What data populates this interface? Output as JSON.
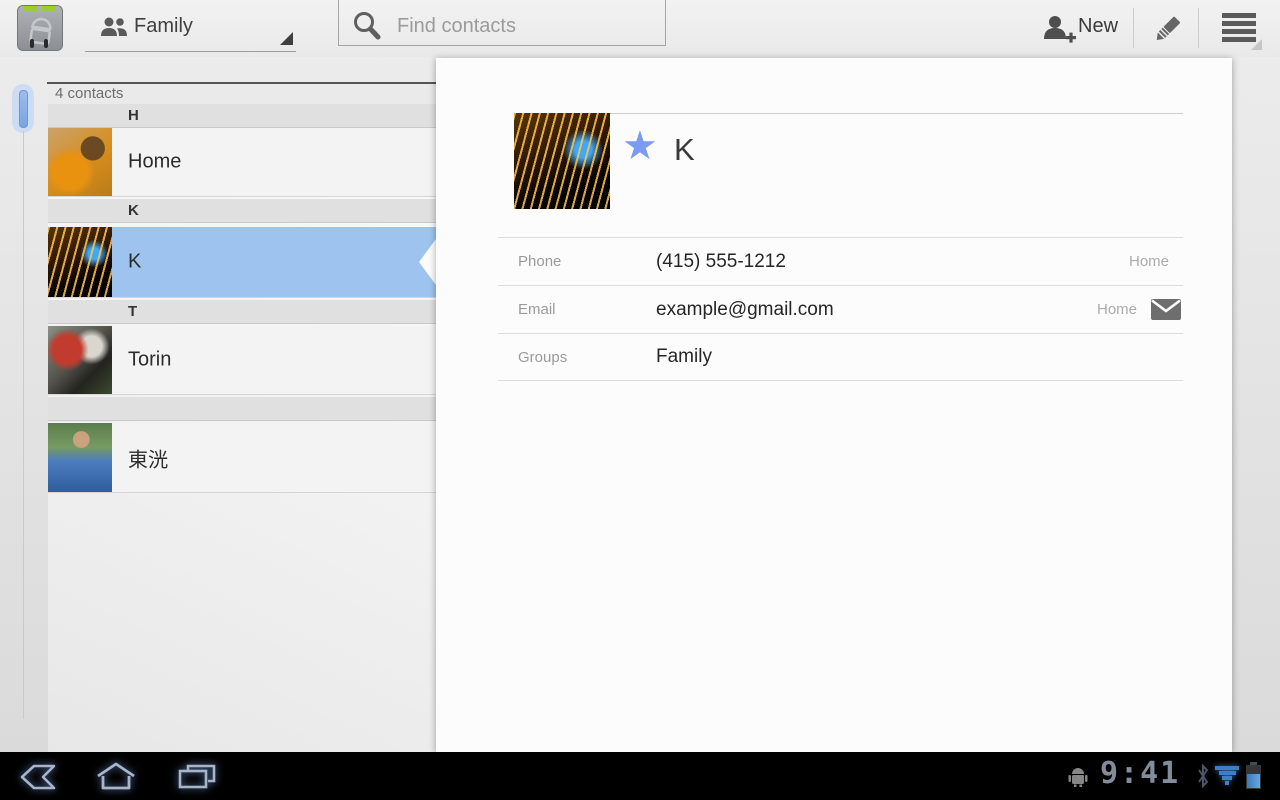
{
  "action_bar": {
    "group_selector_label": "Family",
    "search_placeholder": "Find contacts",
    "new_button_label": "New",
    "icons": [
      "contacts-app-icon",
      "group-icon",
      "search-icon",
      "add-contact-icon",
      "pencil-icon",
      "menu-icon"
    ]
  },
  "contact_list": {
    "count_label": "4 contacts",
    "sections": [
      {
        "letter": "H",
        "contacts": [
          {
            "name": "Home",
            "photo": "pumpkin-child"
          }
        ]
      },
      {
        "letter": "K",
        "contacts": [
          {
            "name": "K",
            "photo": "fireworks",
            "selected": true
          }
        ]
      },
      {
        "letter": "T",
        "contacts": [
          {
            "name": "Torin",
            "photo": "football"
          }
        ]
      },
      {
        "letter": "",
        "contacts": [
          {
            "name": "東洸",
            "photo": "life-vest"
          }
        ]
      }
    ]
  },
  "detail_panel": {
    "name": "K",
    "starred": true,
    "star_glyph": "★",
    "photo": "fireworks",
    "fields": [
      {
        "label": "Phone",
        "value": "(415) 555-1212",
        "type": "Home",
        "action_icon": ""
      },
      {
        "label": "Email",
        "value": "example@gmail.com",
        "type": "Home",
        "action_icon": "email-icon"
      },
      {
        "label": "Groups",
        "value": "Family",
        "type": "",
        "action_icon": ""
      }
    ]
  },
  "system_bar": {
    "time": "9:41",
    "icons": [
      "back-icon",
      "home-icon",
      "recent-apps-icon",
      "android-robot-icon",
      "bluetooth-icon",
      "wifi-icon",
      "battery-icon"
    ]
  },
  "colors": {
    "selection_blue": "#9fc3ef",
    "star_blue": "#7b9bf0",
    "status_blue": "#3e7ec6",
    "section_header_bg": "#e0e0e0",
    "card_bg": "#fcfcfc"
  }
}
